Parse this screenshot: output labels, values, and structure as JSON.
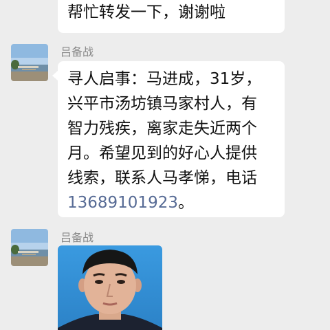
{
  "messages": {
    "top_bubble": {
      "text": "帮忙转发一下，谢谢啦"
    },
    "msg1": {
      "sender": "吕备战",
      "lines": [
        "寻人启事：马进成，31岁，",
        "兴平市汤坊镇马家村人，有",
        "智力残疾，离家走失近两个",
        "月。希望见到的好心人提供",
        "线索，联系人马孝悌，电话"
      ],
      "phone": "13689101923",
      "trailing": "。"
    },
    "msg2": {
      "sender": "吕备战",
      "photo": "portrait-photo"
    }
  },
  "colors": {
    "background": "#ededed",
    "bubble": "#ffffff",
    "link": "#576b95",
    "name": "#888888",
    "photo_bg": "#2f8fd4"
  },
  "icons": {
    "avatar": "lakeside-landscape-avatar"
  }
}
